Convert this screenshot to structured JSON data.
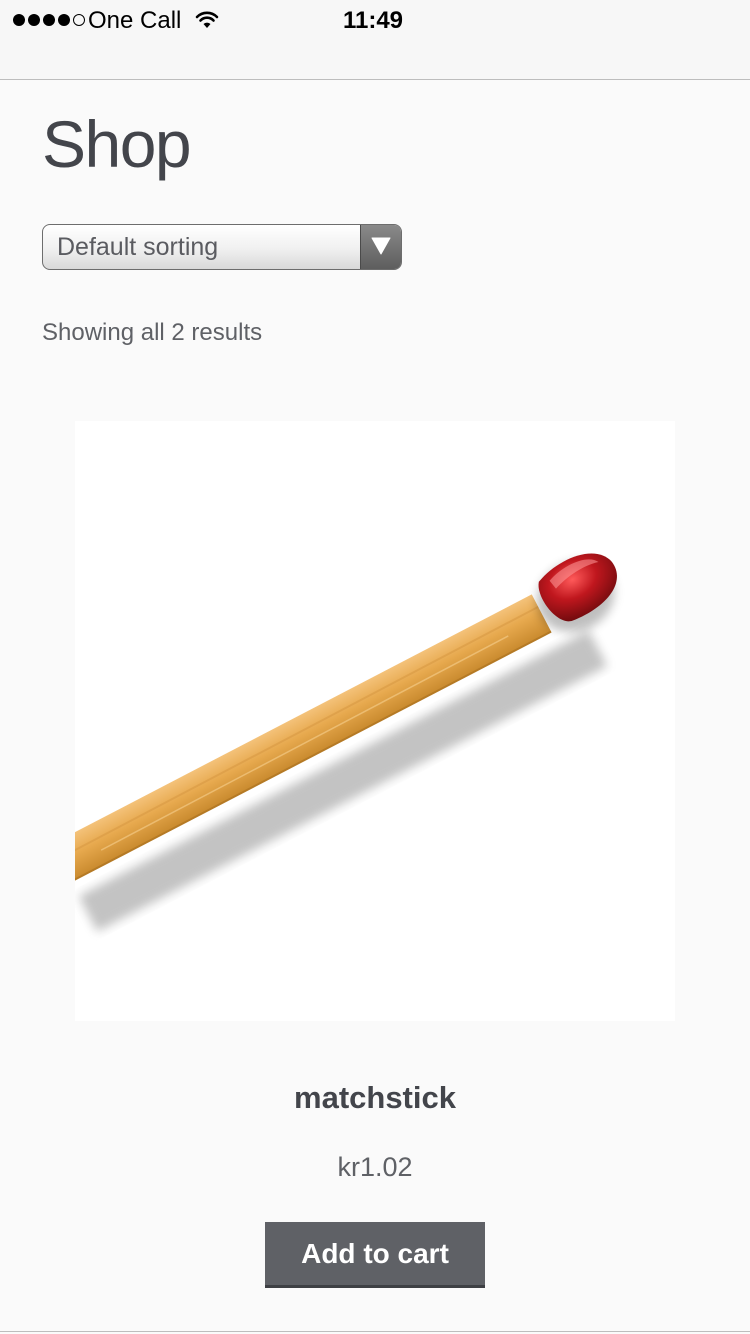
{
  "status_bar": {
    "signal_bars_filled": 4,
    "signal_bars_total": 5,
    "carrier": "One Call",
    "time": "11:49"
  },
  "page": {
    "title": "Shop"
  },
  "sorting": {
    "selected": "Default sorting"
  },
  "results": {
    "count_text": "Showing all 2 results"
  },
  "product": {
    "name": "matchstick",
    "price": "kr1.02",
    "add_to_cart_label": "Add to cart"
  },
  "colors": {
    "button_bg": "#5f6166",
    "text": "#43454b",
    "match_head": "#c0171e",
    "match_stick": "#e7a94e"
  }
}
